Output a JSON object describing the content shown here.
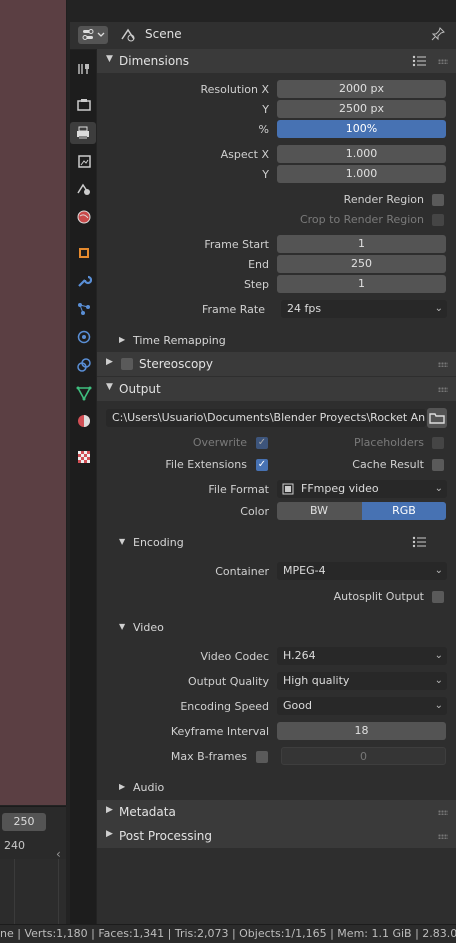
{
  "header": {
    "context_label": "Scene"
  },
  "timeline": {
    "end_frame": "250",
    "tick_label": "240"
  },
  "sections": {
    "dimensions": "Dimensions",
    "time_remapping": "Time Remapping",
    "stereoscopy": "Stereoscopy",
    "output": "Output",
    "encoding": "Encoding",
    "video": "Video",
    "audio": "Audio",
    "metadata": "Metadata",
    "post_processing": "Post Processing"
  },
  "dimensions": {
    "resolution_x_label": "Resolution X",
    "resolution_x": "2000 px",
    "y_label": "Y",
    "resolution_y": "2500 px",
    "percent_label": "%",
    "percent": "100%",
    "aspect_x_label": "Aspect X",
    "aspect_x": "1.000",
    "aspect_y_label": "Y",
    "aspect_y": "1.000",
    "render_region": "Render Region",
    "crop_region": "Crop to Render Region",
    "frame_start_label": "Frame Start",
    "frame_start": "1",
    "end_label": "End",
    "frame_end": "250",
    "step_label": "Step",
    "step": "1",
    "frame_rate_label": "Frame Rate",
    "frame_rate": "24 fps"
  },
  "output": {
    "path": "C:\\Users\\Usuario\\Documents\\Blender Proyects\\Rocket Anima...",
    "overwrite": "Overwrite",
    "placeholders": "Placeholders",
    "file_extensions": "File Extensions",
    "cache_result": "Cache Result",
    "file_format_label": "File Format",
    "file_format": "FFmpeg video",
    "color_label": "Color",
    "color_bw": "BW",
    "color_rgb": "RGB"
  },
  "encoding": {
    "container_label": "Container",
    "container": "MPEG-4",
    "autosplit": "Autosplit Output"
  },
  "video": {
    "codec_label": "Video Codec",
    "codec": "H.264",
    "quality_label": "Output Quality",
    "quality": "High quality",
    "speed_label": "Encoding Speed",
    "speed": "Good",
    "keyframe_label": "Keyframe Interval",
    "keyframe": "18",
    "bframes_label": "Max B-frames",
    "bframes": "0"
  },
  "statusbar": {
    "text": "ne | Verts:1,180 | Faces:1,341 | Tris:2,073 | Objects:1/1,165 | Mem: 1.1 GiB | 2.83.0"
  },
  "colors": {
    "accent": "#4772b3",
    "viewport": "#5b3f43",
    "panel": "#2e2e2e"
  }
}
